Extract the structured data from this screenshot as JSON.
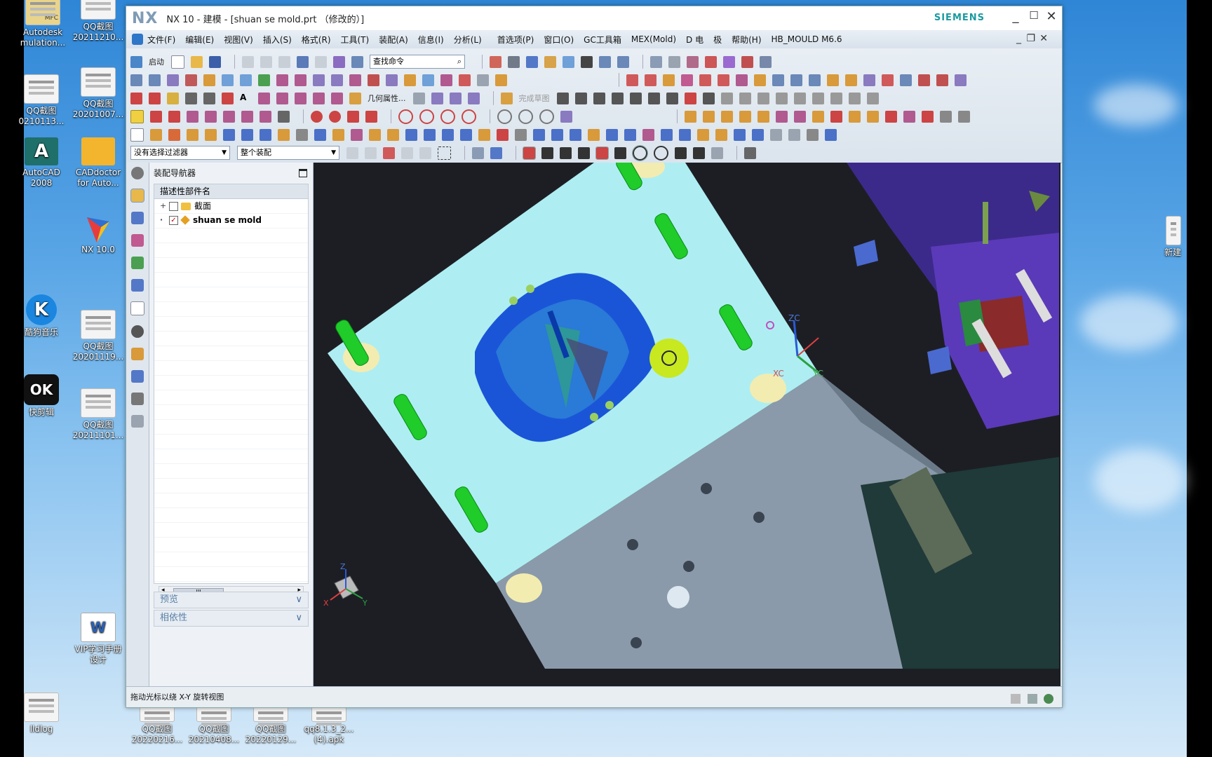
{
  "desktop": {
    "icons_left": [
      {
        "label": "Autodesk\nmulation...",
        "icon": "autodesk-icon"
      },
      {
        "label": "QQ截图\n20211210...",
        "icon": "qq-screenshot-icon"
      },
      {
        "label": "QQ截图\n0210113...",
        "icon": "qq-screenshot-icon"
      },
      {
        "label": "QQ截图\n20201007...",
        "icon": "qq-screenshot-icon"
      },
      {
        "label": "AutoCAD\n2008",
        "icon": "autocad-icon"
      },
      {
        "label": "CADdoctor\nfor Auto...",
        "icon": "caddoctor-icon"
      },
      {
        "label": "NX 10.0",
        "icon": "nx-icon"
      },
      {
        "label": "酷狗音乐",
        "icon": "kugou-icon"
      },
      {
        "label": "QQ截图\n20201119...",
        "icon": "qq-screenshot-icon"
      },
      {
        "label": "快剪辑",
        "icon": "kuaijianji-icon"
      },
      {
        "label": "QQ截图\n20211101...",
        "icon": "qq-screenshot-icon"
      },
      {
        "label": "VIP学习手册\n设计",
        "icon": "word-doc-icon"
      },
      {
        "label": "lldlog",
        "icon": "text-file-icon"
      }
    ],
    "icons_bottom": [
      {
        "label": "QQ截图\n20220216..."
      },
      {
        "label": "QQ截图\n20210408..."
      },
      {
        "label": "QQ截图\n20220129..."
      },
      {
        "label": "qq8.1.3_2...\n(4).apk"
      }
    ],
    "icon_right": {
      "label": "新建"
    },
    "autodesk_badge": "MFC"
  },
  "window": {
    "logo": "NX",
    "title": "NX 10 - 建模 - [shuan se mold.prt （修改的）]",
    "brand": "SIEMENS",
    "controls": {
      "minimize": "_",
      "maximize": "☐",
      "close": "✕"
    }
  },
  "menu": {
    "items": [
      "文件(F)",
      "编辑(E)",
      "视图(V)",
      "插入(S)",
      "格式(R)",
      "工具(T)",
      "装配(A)",
      "信息(I)",
      "分析(L)",
      "首选项(P)",
      "窗口(O)",
      "GC工具箱",
      "MEX(Mold)",
      "D 电",
      "极",
      "帮助(H)",
      "HB_MOULD M6.6"
    ],
    "sub_controls": {
      "minimize": "_",
      "restore": "❐",
      "close": "✕"
    }
  },
  "toolbar": {
    "start_label": "启动",
    "find_placeholder": "查找命令",
    "geom_props_label": "几何属性...",
    "sketch_done_label": "完成草图",
    "filter_select": "没有选择过滤器",
    "assembly_select": "整个装配"
  },
  "navigator": {
    "title": "装配导航器",
    "column_header": "描述性部件名",
    "nodes": [
      {
        "label": "截面",
        "checked": false,
        "type": "folder"
      },
      {
        "label": "shuan se mold",
        "checked": true,
        "type": "part"
      }
    ],
    "scroll_thumb": "III",
    "panels": [
      {
        "label": "预览"
      },
      {
        "label": "相依性"
      }
    ]
  },
  "viewport": {
    "axis_labels": {
      "zc": "ZC",
      "yc": "YC",
      "xc": "XC"
    },
    "triad": {
      "x": "X",
      "y": "Y",
      "z": "Z"
    }
  },
  "status": {
    "text": "拖动光标以绕 X-Y 旋转视图"
  },
  "colors": {
    "plate": "#aeeef2",
    "cavity": "#1a55d8",
    "bolt": "#1fcc2a",
    "boss": "#f3ecb0",
    "background": "#1d1e24",
    "rotate_cursor": "#c8e820"
  }
}
